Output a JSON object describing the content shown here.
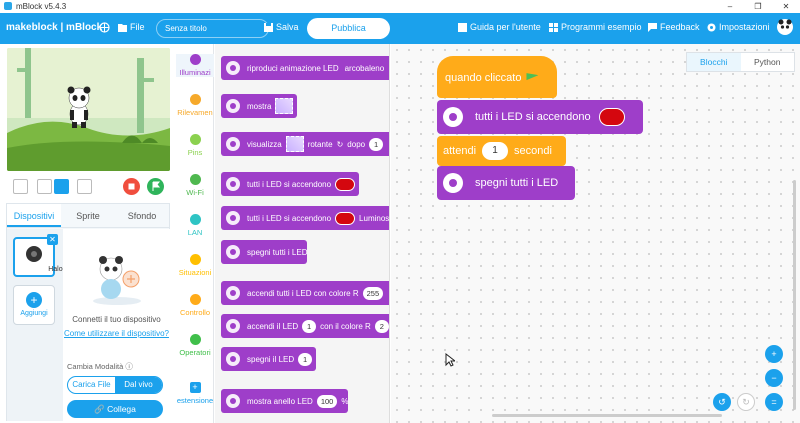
{
  "window": {
    "title": "mBlock v5.4.3",
    "controls": [
      "–",
      "❐",
      "✕"
    ]
  },
  "menubar": {
    "brand": "makeblock | mBlock",
    "file_label": "File",
    "project_title": "Senza titolo",
    "save_label": "Salva",
    "publish_label": "Pubblica",
    "guide_label": "Guida per l'utente",
    "examples_label": "Programmi esempio",
    "feedback_label": "Feedback",
    "settings_label": "Impostazioni"
  },
  "panel": {
    "tabs": [
      "Dispositivi",
      "Sprite",
      "Sfondo"
    ],
    "device_name": "Halocode",
    "add_label": "Aggiungi",
    "connect_text": "Connetti il tuo dispositivo",
    "howto_text": "Come utilizzare il dispositivo?",
    "mode_label": "Cambia Modalità",
    "mode_upload": "Carica File",
    "mode_live": "Dal vivo",
    "connect_button": "Collega"
  },
  "categories": [
    {
      "label": "Illuminazi",
      "color": "#9e3ec9"
    },
    {
      "label": "Rilevamen",
      "color": "#f6a92a"
    },
    {
      "label": "Pins",
      "color": "#8bd14f"
    },
    {
      "label": "Wi-Fi",
      "color": "#4fb84f"
    },
    {
      "label": "LAN",
      "color": "#2ec4c4"
    },
    {
      "label": "Situazioni",
      "color": "#ffbf00"
    },
    {
      "label": "Controllo",
      "color": "#ffab19"
    },
    {
      "label": "Operatori",
      "color": "#40bf4a"
    },
    {
      "label": "estensione",
      "color": "#1ba1ec"
    }
  ],
  "palette": {
    "b1": "riproduci animazione LED",
    "b1_val": "arcobaleno",
    "b2": "mostra",
    "b3": "visualizza",
    "b3_mid": "rotante",
    "b3_after": "dopo",
    "b3_val": "1",
    "b4": "tutti i LED si accendono",
    "b5": "tutti i LED si accendono",
    "b5_after": "Luminos",
    "b6": "spegni tutti i LED",
    "b7": "accendi tutti i LED con colore R",
    "b7_val": "255",
    "b8": "accendi il LED",
    "b8_val": "1",
    "b8_mid": "con il colore R",
    "b8_val2": "2",
    "b9": "spegni il LED",
    "b9_val": "1",
    "b10": "mostra anello LED",
    "b10_val": "100",
    "b10_unit": "%"
  },
  "script": {
    "hat": "quando cliccato",
    "block1": "tutti i LED si accendono",
    "wait_pre": "attendi",
    "wait_val": "1",
    "wait_post": "secondi",
    "block3": "spegni tutti i LED"
  },
  "mode_tabs": {
    "blocks": "Blocchi",
    "python": "Python"
  }
}
